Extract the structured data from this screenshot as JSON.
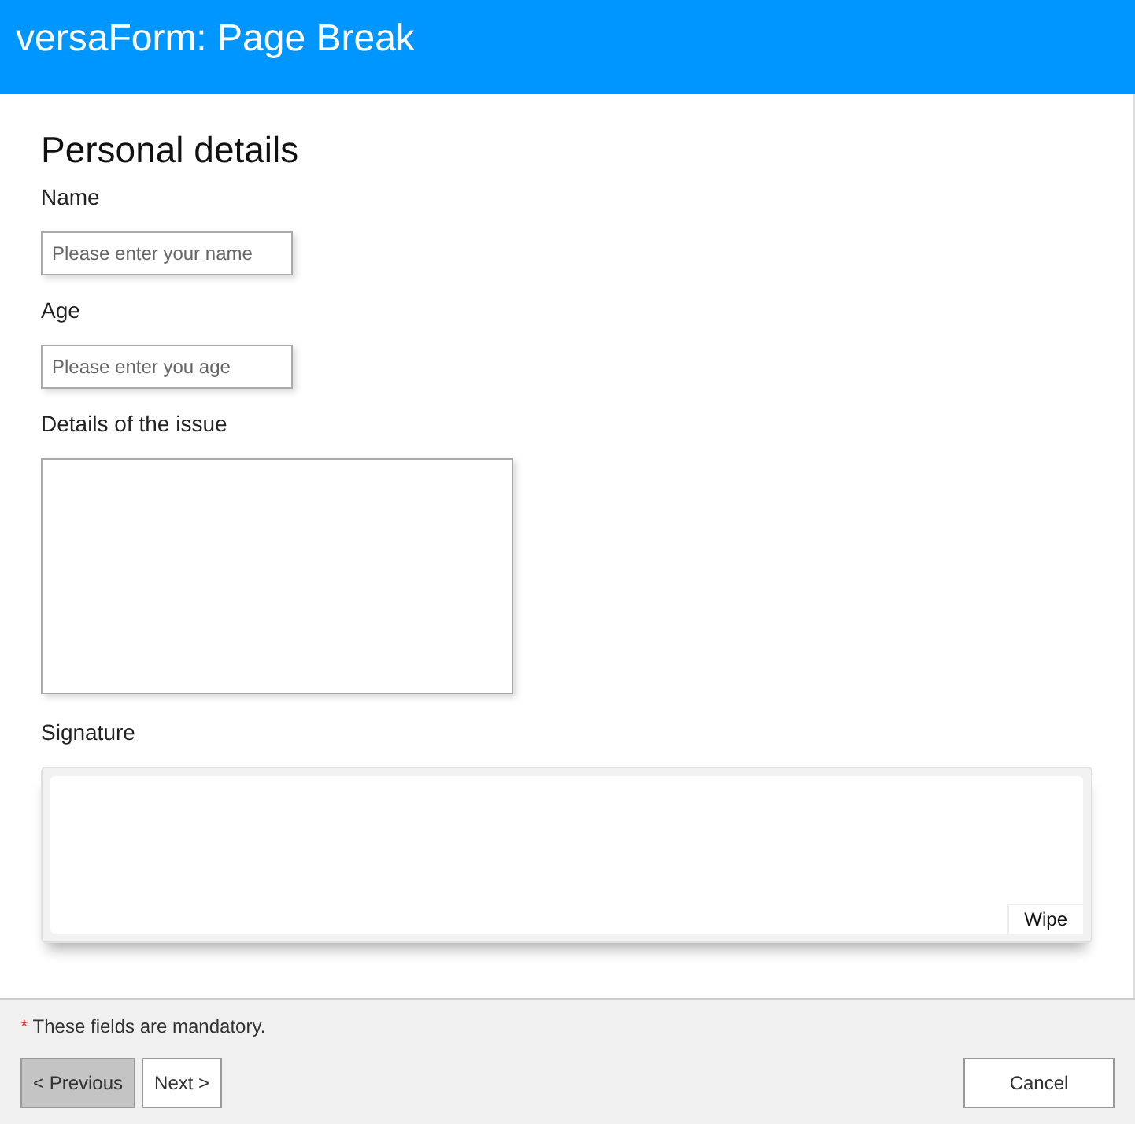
{
  "window": {
    "title": "versaForm: Page Break"
  },
  "section": {
    "title": "Personal details"
  },
  "fields": [
    {
      "kind": "input",
      "label": "Name",
      "placeholder": "Please enter your name"
    },
    {
      "kind": "input",
      "label": "Age",
      "placeholder": "Please enter you age"
    },
    {
      "kind": "textarea",
      "label": "Details of the issue"
    },
    {
      "kind": "signature",
      "label": "Signature",
      "action": "Wipe"
    }
  ],
  "footer": {
    "mark": "*",
    "note": "These fields are mandatory.",
    "nav_buttons": [
      {
        "label": "< Previous",
        "pressed": true
      },
      {
        "label": "Next >",
        "pressed": false
      }
    ],
    "cancel": "Cancel"
  }
}
